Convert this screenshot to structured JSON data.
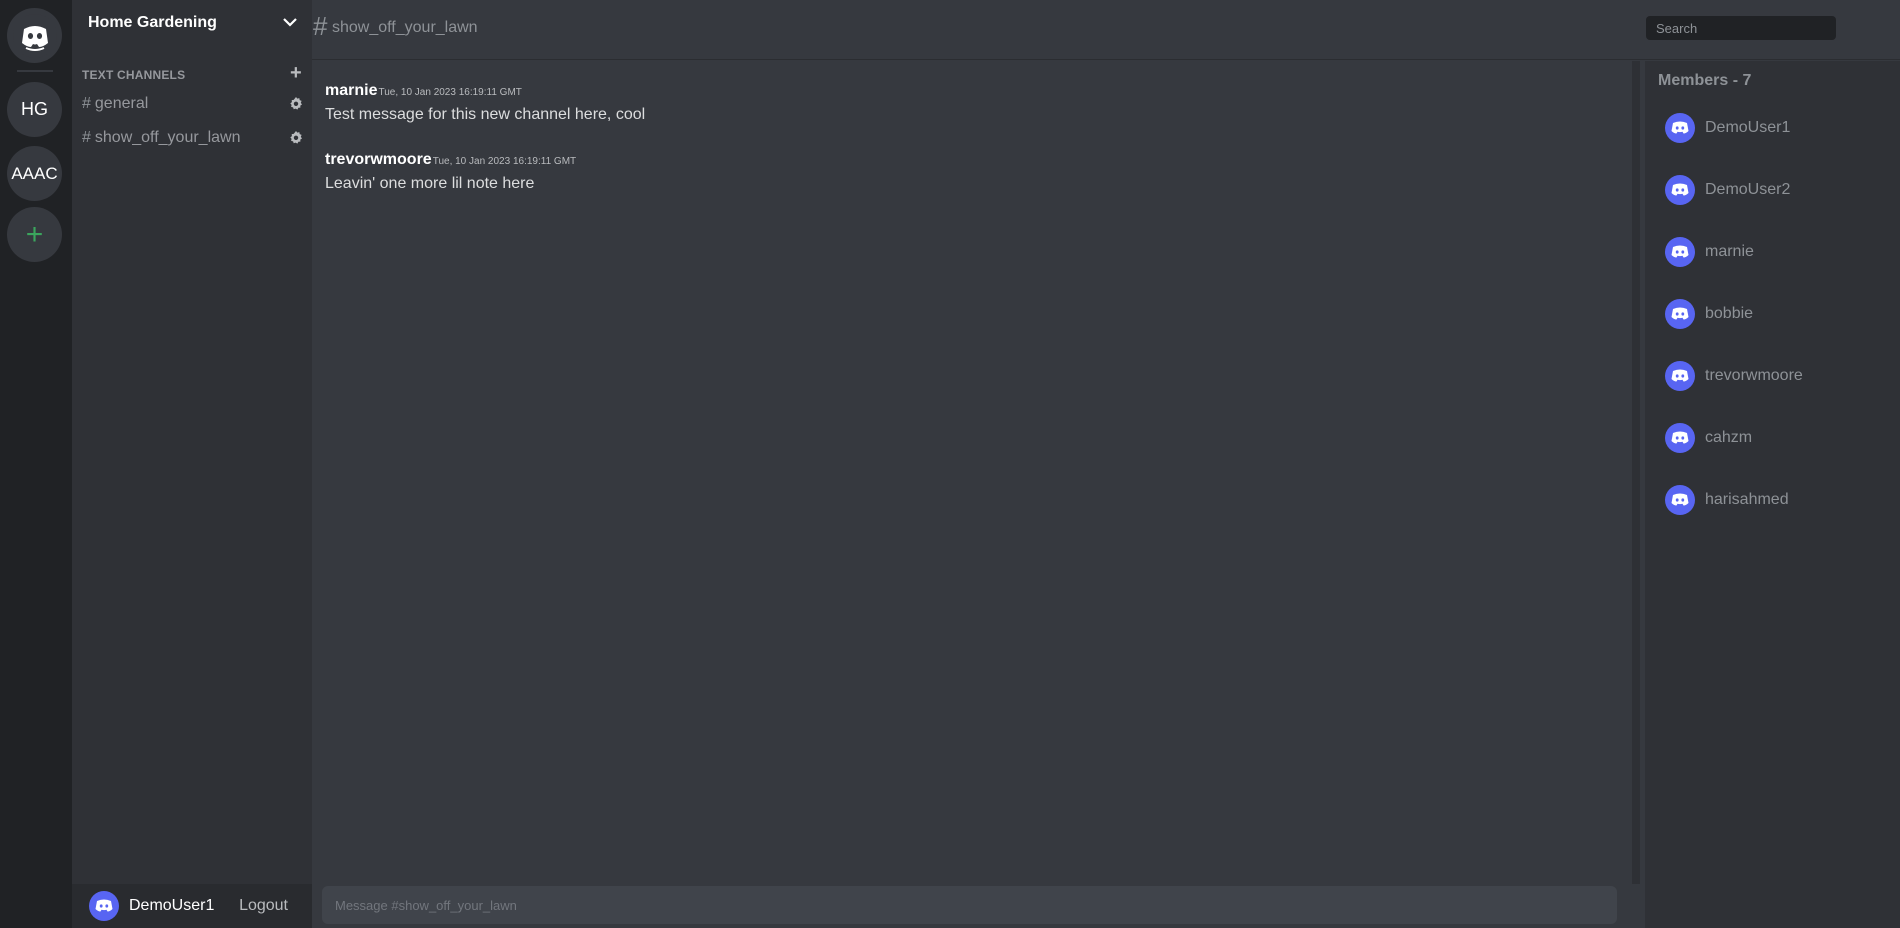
{
  "servers": [
    {
      "label": "HG"
    },
    {
      "label": "AAAC"
    }
  ],
  "add_server_label": "+",
  "server": {
    "name": "Home Gardening",
    "section_label": "TEXT CHANNELS",
    "channels": [
      {
        "hash": "#",
        "name": "general"
      },
      {
        "hash": "#",
        "name": "show_off_your_lawn"
      }
    ]
  },
  "user_panel": {
    "username": "DemoUser1",
    "logout_label": "Logout"
  },
  "topbar": {
    "hash": "#",
    "channel_name": "show_off_your_lawn",
    "search_placeholder": "Search"
  },
  "messages": [
    {
      "author": "marnie",
      "timestamp": "Tue, 10 Jan 2023 16:19:11 GMT",
      "text": "Test message for this new channel here, cool"
    },
    {
      "author": "trevorwmoore",
      "timestamp": "Tue, 10 Jan 2023 16:19:11 GMT",
      "text": "Leavin' one more lil note here"
    }
  ],
  "composer": {
    "placeholder": "Message #show_off_your_lawn"
  },
  "members": {
    "title": "Members - 7",
    "list": [
      {
        "name": "DemoUser1"
      },
      {
        "name": "DemoUser2"
      },
      {
        "name": "marnie"
      },
      {
        "name": "bobbie"
      },
      {
        "name": "trevorwmoore"
      },
      {
        "name": "cahzm"
      },
      {
        "name": "harisahmed"
      }
    ]
  },
  "colors": {
    "blurple": "#5865f2",
    "green_add": "#3ba55d"
  }
}
